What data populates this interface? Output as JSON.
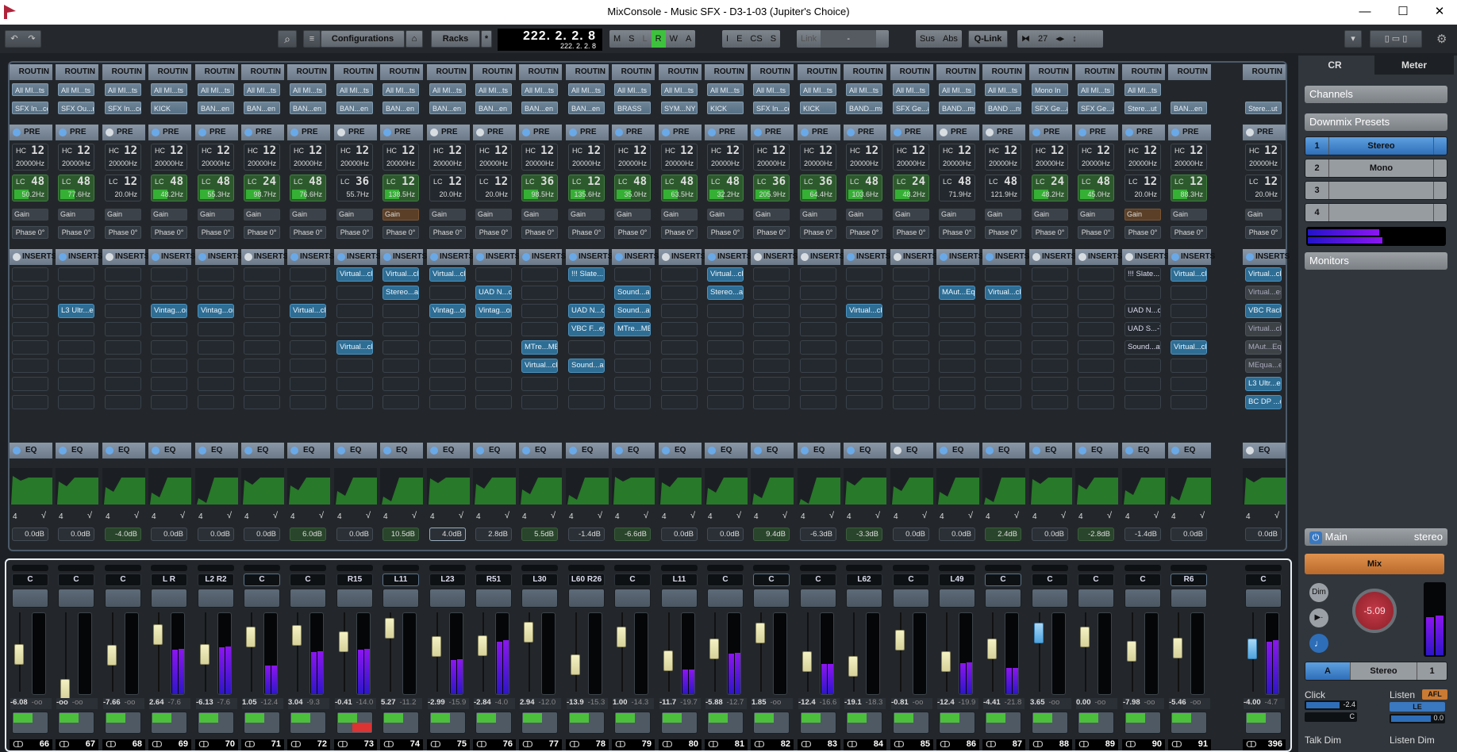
{
  "window": {
    "title": "MixConsole - Music SFX - D3-1-03 (Jupiter's Choice)",
    "minimize": "—",
    "maximize": "☐",
    "close": "✕"
  },
  "toolbar": {
    "undo_icon": "↶",
    "redo_icon": "↷",
    "search_icon": "⌕",
    "list_icon": "≡",
    "configurations_label": "Configurations",
    "snapshot_icon": "⌂",
    "racks_label": "Racks",
    "racks_star": "*",
    "timecode_main": "222. 2. 2.   8",
    "timecode_sub": "222. 2. 2.   8",
    "state_buttons": [
      "M",
      "S",
      "L",
      "R",
      "W",
      "A"
    ],
    "active_state": "R",
    "io_buttons": [
      "I",
      "E",
      "CS",
      "S"
    ],
    "link_label": "Link",
    "link_value": "-",
    "sus_label": "Sus",
    "abs_label": "Abs",
    "qlink_label": "Q-Link",
    "channel_width": "27",
    "settings_icon": "⚙"
  },
  "routing": {
    "header": "ROUTIN",
    "inputs": [
      "All MI...ts",
      "All MI...ts",
      "All MI...ts",
      "All MI...ts",
      "All MI...ts",
      "All MI...ts",
      "All MI...ts",
      "All MI...ts",
      "All MI...ts",
      "All MI...ts",
      "All MI...ts",
      "All MI...ts",
      "All MI...ts",
      "All MI...ts",
      "All MI...ts",
      "All MI...ts",
      "All MI...ts",
      "All MI...ts",
      "All MI...ts",
      "All MI...ts",
      "All MI...ts",
      "All MI...ts",
      "Mono In",
      "All MI...ts",
      "All MI...ts",
      ""
    ],
    "outputs": [
      "SFX In...ce",
      "SFX Ou...rs",
      "SFX In...ce",
      "KICK",
      "BAN...en",
      "BAN...en",
      "BAN...en",
      "BAN...en",
      "BAN...en",
      "BAN...en",
      "BAN...en",
      "BAN...en",
      "BAN...en",
      "BRASS",
      "SYM...NY",
      "KICK",
      "SFX In...ce",
      "KICK",
      "BAND...ms",
      "SFX Ge...al",
      "BAND...ms",
      "BAND ...ns",
      "SFX Ge...al",
      "SFX Ge...al",
      "Stere...ut",
      "BAN...en",
      "Stere...ut"
    ]
  },
  "pre": {
    "header": "PRE",
    "enabled": [
      1,
      1,
      0,
      1,
      1,
      1,
      1,
      0,
      1,
      0,
      0,
      1,
      1,
      1,
      1,
      1,
      1,
      1,
      1,
      1,
      0,
      0,
      1,
      1,
      1,
      1,
      0
    ],
    "hc": {
      "label": "HC",
      "slope": "12",
      "freq": "20000Hz"
    },
    "lc_label": "LC",
    "lc_slope": [
      "48",
      "48",
      "12",
      "48",
      "48",
      "24",
      "48",
      "36",
      "12",
      "12",
      "12",
      "36",
      "12",
      "48",
      "48",
      "48",
      "36",
      "36",
      "48",
      "24",
      "48",
      "48",
      "24",
      "48",
      "12",
      "12",
      "12"
    ],
    "lc_freq": [
      "50.2Hz",
      "77.6Hz",
      "20.0Hz",
      "48.2Hz",
      "55.3Hz",
      "98.7Hz",
      "76.6Hz",
      "55.7Hz",
      "138.5Hz",
      "20.0Hz",
      "20.0Hz",
      "98.5Hz",
      "135.6Hz",
      "35.0Hz",
      "63.5Hz",
      "32.2Hz",
      "205.9Hz",
      "64.4Hz",
      "103.6Hz",
      "48.2Hz",
      "71.9Hz",
      "121.9Hz",
      "48.2Hz",
      "45.0Hz",
      "20.0Hz",
      "88.3Hz",
      "20.0Hz"
    ],
    "lc_on": [
      1,
      1,
      0,
      1,
      1,
      1,
      1,
      0,
      1,
      0,
      0,
      1,
      1,
      1,
      1,
      1,
      1,
      1,
      1,
      1,
      0,
      0,
      1,
      1,
      0,
      1,
      0
    ],
    "gain_label": "Gain",
    "gain_orange": [
      0,
      0,
      0,
      0,
      0,
      0,
      0,
      0,
      1,
      0,
      0,
      0,
      0,
      0,
      0,
      0,
      0,
      0,
      0,
      0,
      0,
      0,
      0,
      0,
      1,
      0,
      0
    ],
    "phase_label": "Phase 0°"
  },
  "inserts": {
    "header": "INSERTS",
    "enabled": [
      0,
      1,
      0,
      1,
      1,
      0,
      1,
      1,
      1,
      1,
      1,
      1,
      1,
      1,
      0,
      1,
      0,
      0,
      1,
      0,
      1,
      1,
      0,
      0,
      0,
      1,
      1
    ],
    "slots": [
      [
        "",
        "",
        "",
        "",
        "",
        ""
      ],
      [
        "",
        "",
        "L3 Ultr...eo",
        "",
        "",
        ""
      ],
      [
        "",
        "",
        "",
        "",
        "",
        ""
      ],
      [
        "",
        "",
        "Vintag...or",
        "",
        "",
        ""
      ],
      [
        "",
        "",
        "Vintag...or",
        "",
        "",
        ""
      ],
      [
        "",
        "",
        "",
        "",
        "",
        ""
      ],
      [
        "",
        "",
        "Virtual...ck",
        "",
        "",
        ""
      ],
      [
        "Virtual...ck",
        "",
        "",
        "",
        "Virtual...ck",
        ""
      ],
      [
        "Virtual...ck",
        "Stereo...ay",
        "",
        "",
        "",
        ""
      ],
      [
        "Virtual...ck",
        "",
        "Vintag...or",
        "",
        "",
        ""
      ],
      [
        "",
        "UAD N...cy",
        "Vintag...or",
        "",
        "",
        ""
      ],
      [
        "",
        "",
        "",
        "",
        "MTre...MB",
        "Virtual...ck"
      ],
      [
        "!!! Slate...!!",
        "",
        "UAD N...cy",
        "VBC F...ey",
        "",
        "Sound...ay"
      ],
      [
        "",
        "Sound...ay",
        "Sound...ay",
        "MTre...MB",
        "",
        ""
      ],
      [
        "",
        "",
        "",
        "",
        "",
        ""
      ],
      [
        "Virtual...ck",
        "Stereo...ay",
        "",
        "",
        "",
        ""
      ],
      [
        "",
        "",
        "",
        "",
        "",
        ""
      ],
      [
        "",
        "",
        "",
        "",
        "",
        ""
      ],
      [
        "",
        "",
        "Virtual...ck",
        "",
        "",
        ""
      ],
      [
        "",
        "",
        "",
        "",
        "",
        ""
      ],
      [
        "",
        "MAut...Eq",
        "",
        "",
        "",
        ""
      ],
      [
        "",
        "Virtual...ck",
        "",
        "",
        "",
        ""
      ],
      [
        "",
        "",
        "",
        "",
        "",
        ""
      ],
      [
        "",
        "",
        "",
        "",
        "",
        ""
      ],
      [
        "!!! Slate...!!",
        "",
        "UAD N...cy",
        "UAD S...-T",
        "Sound...ay",
        ""
      ],
      [
        "Virtual...ck",
        "",
        "",
        "",
        "Virtual...ck",
        ""
      ],
      [
        "Virtual...ck",
        "Virtual...es",
        "VBC Rack",
        "Virtual...ck",
        "MAut...Eq",
        "MEqua...er",
        "L3 Ultr...eo",
        "BC DP ...o)"
      ]
    ]
  },
  "eq": {
    "header": "EQ",
    "enabled": [
      1,
      1,
      1,
      1,
      1,
      1,
      1,
      1,
      1,
      1,
      1,
      1,
      1,
      1,
      1,
      1,
      1,
      1,
      1,
      0,
      1,
      1,
      1,
      1,
      1,
      1,
      0
    ],
    "bands": "4",
    "gain": [
      "0.0dB",
      "0.0dB",
      "-4.0dB",
      "0.0dB",
      "0.0dB",
      "0.0dB",
      "6.0dB",
      "0.0dB",
      "10.5dB",
      "4.0dB",
      "2.8dB",
      "5.5dB",
      "-1.4dB",
      "-6.6dB",
      "0.0dB",
      "0.0dB",
      "9.4dB",
      "-6.3dB",
      "-3.3dB",
      "0.0dB",
      "0.0dB",
      "2.4dB",
      "0.0dB",
      "-2.8dB",
      "-1.4dB",
      "0.0dB",
      "0.0dB"
    ],
    "gain_active": [
      0,
      0,
      1,
      0,
      0,
      0,
      1,
      0,
      1,
      0,
      0,
      1,
      0,
      1,
      0,
      0,
      1,
      0,
      1,
      0,
      0,
      1,
      0,
      1,
      0,
      0,
      0
    ]
  },
  "faders": {
    "pan": [
      "C",
      "C",
      "C",
      "L R",
      "L2 R2",
      "C",
      "C",
      "R15",
      "L11",
      "L23",
      "R51",
      "L30",
      "L60 R26",
      "C",
      "L11",
      "C",
      "C",
      "C",
      "L62",
      "C",
      "L49",
      "C",
      "C",
      "C",
      "C",
      "R6",
      "C"
    ],
    "pan_selected": [
      0,
      0,
      0,
      0,
      0,
      1,
      0,
      0,
      1,
      0,
      0,
      0,
      0,
      0,
      0,
      0,
      1,
      0,
      0,
      0,
      0,
      1,
      0,
      0,
      0,
      1,
      0
    ],
    "volume": [
      "-6.08",
      "-oo",
      "-7.66",
      "2.64",
      "-6.13",
      "1.05",
      "3.04",
      "-0.41",
      "5.27",
      "-2.99",
      "-2.84",
      "2.94",
      "-13.9",
      "1.00",
      "-11.7",
      "-5.88",
      "1.85",
      "-12.4",
      "-19.1",
      "-0.81",
      "-12.4",
      "-4.41",
      "3.65",
      "0.00",
      "-7.98",
      "-5.46",
      "-4.00"
    ],
    "peak": [
      "-oo",
      "-oo",
      "-oo",
      "-7.6",
      "-7.6",
      "-12.4",
      "-9.3",
      "-14.0",
      "-11.2",
      "-15.9",
      "-4.0",
      "-12.0",
      "-15.3",
      "-14.3",
      "-19.7",
      "-12.7",
      "-oo",
      "-16.6",
      "-18.3",
      "-oo",
      "-19.9",
      "-21.8",
      "-oo",
      "-oo",
      "-oo",
      "-oo",
      "-4.7"
    ],
    "fader_level": [
      0.55,
      0.05,
      0.53,
      0.83,
      0.55,
      0.8,
      0.82,
      0.73,
      0.92,
      0.66,
      0.67,
      0.86,
      0.4,
      0.8,
      0.45,
      0.62,
      0.85,
      0.44,
      0.37,
      0.75,
      0.44,
      0.63,
      0.85,
      0.8,
      0.59,
      0.64,
      0.62
    ],
    "meter_level": [
      0,
      0,
      0,
      0.55,
      0.58,
      0.35,
      0.52,
      0.55,
      0,
      0.42,
      0.65,
      0,
      0,
      0,
      0.3,
      0.5,
      0,
      0.37,
      0,
      0,
      0.38,
      0.32,
      0,
      0,
      0,
      0,
      0.65
    ],
    "record_armed": [
      0,
      0,
      0,
      0,
      0,
      0,
      0,
      1,
      0,
      0,
      0,
      0,
      0,
      0,
      0,
      0,
      0,
      0,
      0,
      0,
      0,
      0,
      0,
      0,
      0,
      0,
      0
    ],
    "channel_numbers": [
      "66",
      "67",
      "68",
      "69",
      "70",
      "71",
      "72",
      "73",
      "74",
      "75",
      "76",
      "77",
      "78",
      "79",
      "80",
      "81",
      "82",
      "83",
      "84",
      "85",
      "86",
      "87",
      "88",
      "89",
      "90",
      "91",
      "396"
    ],
    "link_icon": "ↀ"
  },
  "control_room": {
    "tabs": [
      "CR",
      "Meter"
    ],
    "active_tab": "CR",
    "channels_label": "Channels",
    "downmix_label": "Downmix Presets",
    "presets": [
      {
        "num": "1",
        "name": "Stereo",
        "active": true
      },
      {
        "num": "2",
        "name": "Mono",
        "active": false
      },
      {
        "num": "3",
        "name": "",
        "active": false
      },
      {
        "num": "4",
        "name": "",
        "active": false
      }
    ],
    "monitors_label": "Monitors",
    "main_label": "Main",
    "main_format": "stereo",
    "power_icon": "⏻",
    "mix_label": "Mix",
    "dim_label": "Dim",
    "volume_knob": "-5.09",
    "source_a": "A",
    "source_format": "Stereo",
    "source_num": "1",
    "click_label": "Click",
    "click_level": "-2.4",
    "click_pan": "C",
    "listen_label": "Listen",
    "afl_label": "AFL",
    "listen_le": "LE",
    "listen_level": "0.0",
    "talk_dim_label": "Talk Dim",
    "listen_dim_label": "Listen Dim"
  }
}
